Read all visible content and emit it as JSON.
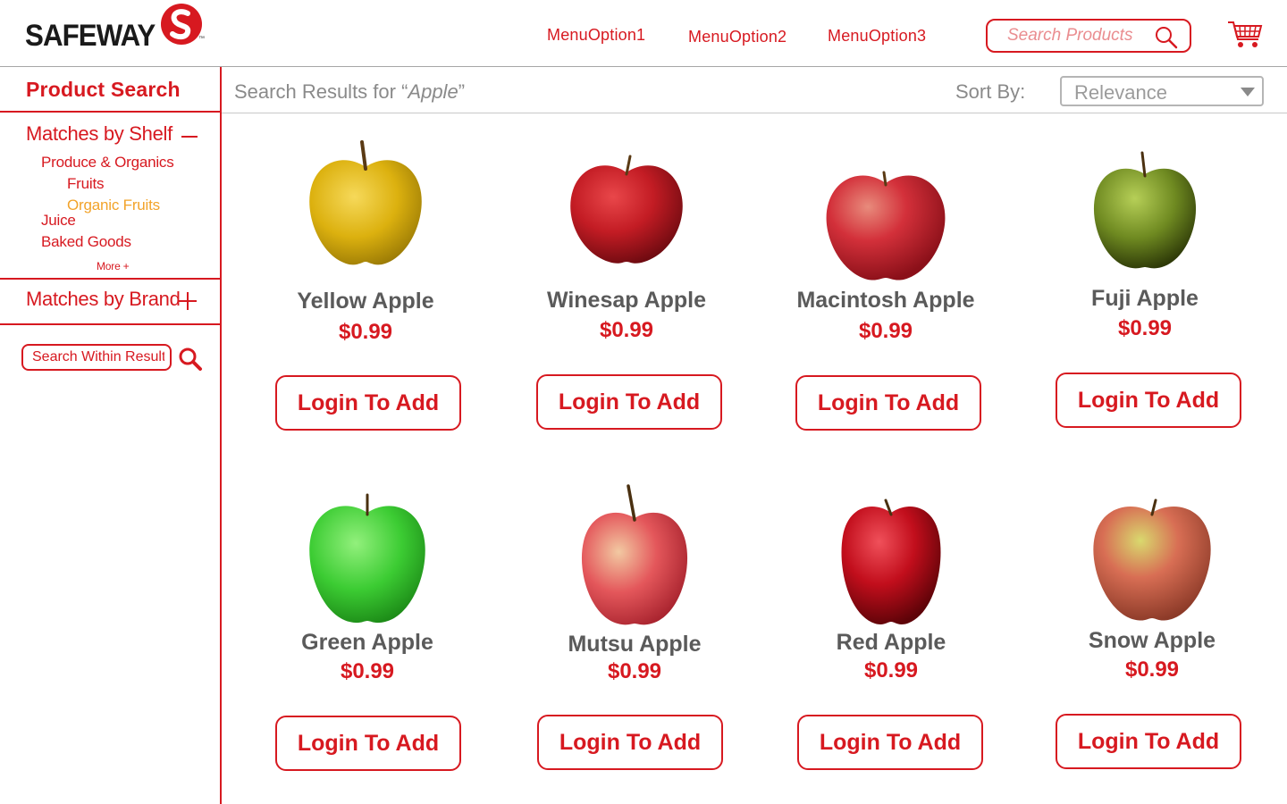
{
  "header": {
    "logo_text": "SAFEWAY",
    "logo_tm": "™",
    "menu": [
      "MenuOption1",
      "MenuOption2",
      "MenuOption3"
    ],
    "search_placeholder": "Search Products",
    "icons": {
      "search": "search-icon",
      "cart": "cart-icon"
    }
  },
  "sidebar": {
    "title": "Product Search",
    "shelf_heading": "Matches by Shelf",
    "shelf_items": [
      "Produce & Organics",
      "Fruits",
      "Organic Fruits",
      "Juice",
      "Baked Goods"
    ],
    "more_label": "More +",
    "brand_heading": "Matches by Brand",
    "within_placeholder": "Search Within Results"
  },
  "results": {
    "prefix": "Search Results for “",
    "query": "Apple",
    "suffix": "”",
    "sort_label": "Sort By:",
    "sort_value": "Relevance"
  },
  "products": [
    {
      "name": "Yellow Apple",
      "price": "$0.99",
      "button": "Login To Add"
    },
    {
      "name": "Winesap Apple",
      "price": "$0.99",
      "button": "Login To Add"
    },
    {
      "name": "Macintosh Apple",
      "price": "$0.99",
      "button": "Login To Add"
    },
    {
      "name": "Fuji Apple",
      "price": "$0.99",
      "button": "Login To Add"
    },
    {
      "name": "Green Apple",
      "price": "$0.99",
      "button": "Login To Add"
    },
    {
      "name": "Mutsu Apple",
      "price": "$0.99",
      "button": "Login To Add"
    },
    {
      "name": "Red Apple",
      "price": "$0.99",
      "button": "Login To Add"
    },
    {
      "name": "Snow Apple",
      "price": "$0.99",
      "button": "Login To Add"
    }
  ],
  "colors": {
    "brand_red": "#d71920",
    "highlight_orange": "#f2a32a",
    "muted_text": "#5a5a5a"
  }
}
